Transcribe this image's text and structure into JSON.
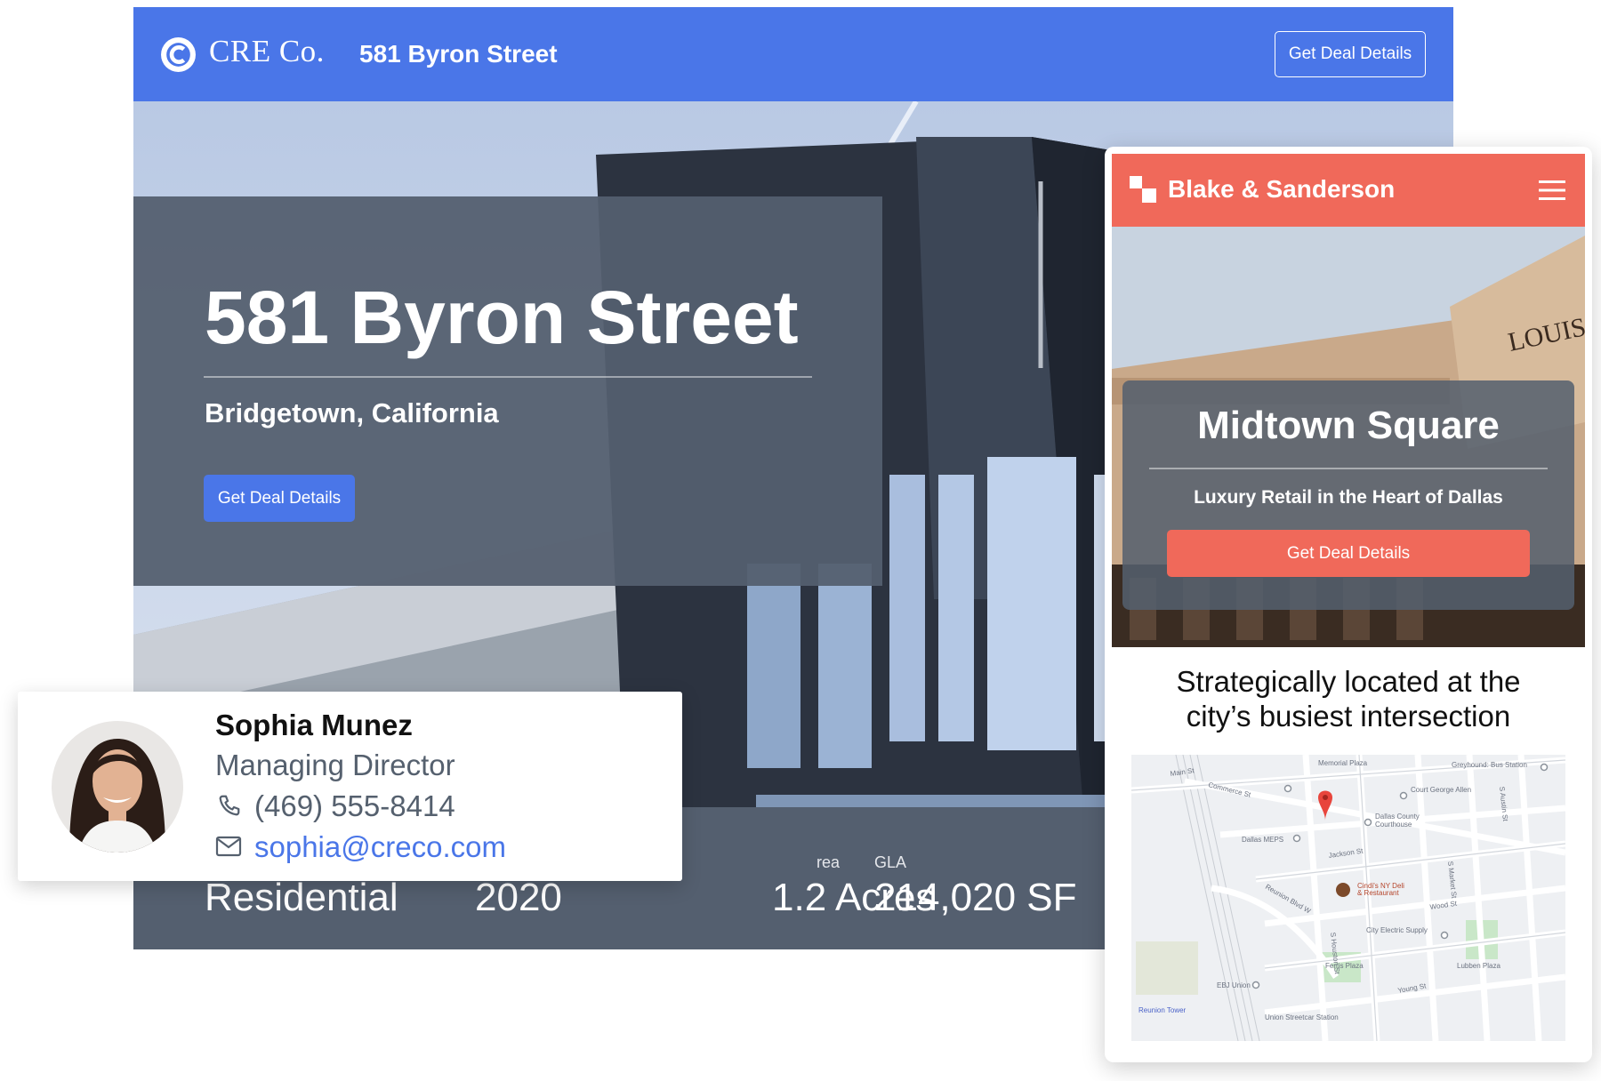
{
  "desktop": {
    "header": {
      "brand": "CRE Co.",
      "title": "581 Byron Street",
      "cta_label": "Get Deal Details"
    },
    "hero": {
      "title": "581 Byron Street",
      "subtitle": "Bridgetown, California",
      "cta_label": "Get Deal Details"
    },
    "stats": [
      {
        "label": "",
        "value": "Residential"
      },
      {
        "label": "",
        "value": "2020"
      },
      {
        "label": "rea",
        "value": "1.2 Acres"
      },
      {
        "label": "GLA",
        "value": "214,020 SF"
      }
    ]
  },
  "contact": {
    "name": "Sophia Munez",
    "role": "Managing Director",
    "phone": "(469) 555-8414",
    "email": "sophia@creco.com"
  },
  "mobile": {
    "header": {
      "brand": "Blake & Sanderson"
    },
    "hero": {
      "storefront_sign": "LOUIS V",
      "title": "Midtown Square",
      "subtitle": "Luxury Retail in the Heart of Dallas",
      "cta_label": "Get Deal Details"
    },
    "tagline_line1": "Strategically located at the",
    "tagline_line2": "city’s busiest intersection",
    "map_labels": {
      "memorial_plaza": "Memorial Plaza",
      "greyhound": "Greyhound: Bus Station",
      "main_st": "Main St",
      "commerce_st": "Commerce St",
      "courthouse_george": "Court George Allen",
      "dallas_county": "Dallas County",
      "courthouse": "Courthouse",
      "dallas_meps": "Dallas MEPS",
      "jackson_st": "Jackson St",
      "cindis_1": "Cindi's NY Deli",
      "cindis_2": "& Restaurant",
      "wood_st": "Wood St",
      "reunion_blvd": "Reunion Blvd W",
      "city_electric": "City Electric Supply",
      "ferris_plaza": "Ferris Plaza",
      "lubben_plaza": "Lubben Plaza",
      "young_st": "Young St",
      "ebj_union": "EBJ Union",
      "reunion_tower": "Reunion Tower",
      "union_station": "Union Streetcar Station",
      "houston_st": "S Houston St",
      "market_st": "S Market St",
      "austin_st": "S Austin St"
    }
  },
  "colors": {
    "cre_blue": "#4a76e8",
    "blake_coral": "#f0695a",
    "overlay_slate": "#545f6f",
    "link_blue": "#4a76e8"
  },
  "icons": [
    "cre-logo-icon",
    "phone-icon",
    "mail-icon",
    "blake-logo-icon",
    "hamburger-menu-icon",
    "map-pin-icon"
  ]
}
